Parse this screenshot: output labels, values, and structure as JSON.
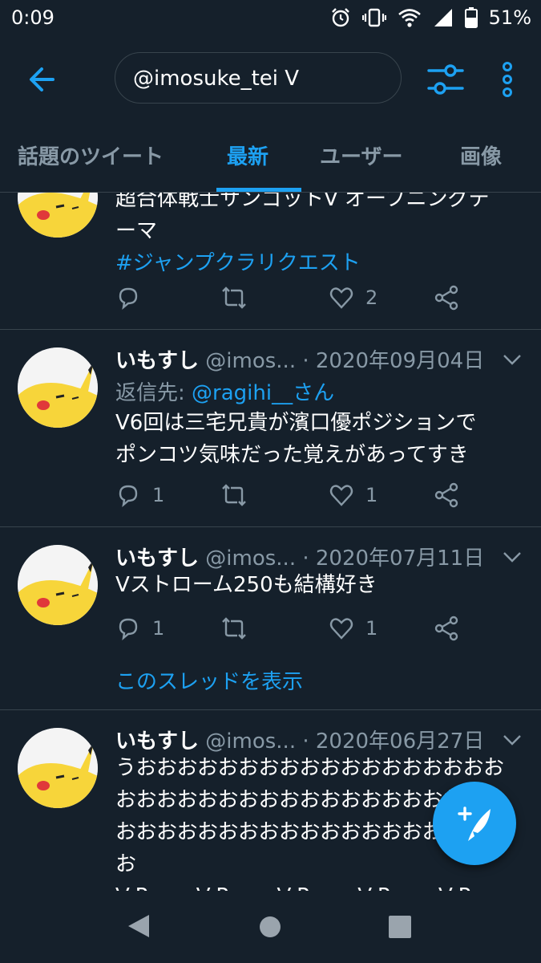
{
  "status": {
    "time": "0:09",
    "battery": "51%",
    "icons": [
      "alarm-icon",
      "vibrate-icon",
      "wifi-icon",
      "signal-icon",
      "battery-icon"
    ]
  },
  "search": {
    "query": "@imosuke_tei V"
  },
  "tabs": [
    {
      "label": "話題のツイート",
      "active": false
    },
    {
      "label": "最新",
      "active": true
    },
    {
      "label": "ユーザー",
      "active": false
    },
    {
      "label": "画像",
      "active": false
    }
  ],
  "colors": {
    "background": "#15202b",
    "accent": "#1da1f2",
    "secondary_text": "#8899a6",
    "divider": "#38444d"
  },
  "tweets": [
    {
      "lines": [
        "超合体戦士サンゴットV オープニングテ",
        "ーマ"
      ],
      "hashtag": "#ジャンプクラリクエスト",
      "likes": "2"
    },
    {
      "name": "いもすし",
      "handle": "@imos...",
      "date": "· 2020年09月04日",
      "reply_label": "返信先:",
      "reply_link": "@ragihi__さん",
      "lines": [
        "V6回は三宅兄貴が濱口優ポジションで",
        "ポンコツ気味だった覚えがあってすき"
      ],
      "replies": "1",
      "likes": "1"
    },
    {
      "name": "いもすし",
      "handle": "@imos...",
      "date": "· 2020年07月11日",
      "lines": [
        "Vストローム250も結構好き"
      ],
      "replies": "1",
      "likes": "1",
      "thread_link": "このスレッドを表示"
    },
    {
      "name": "いもすし",
      "handle": "@imos...",
      "date": "· 2020年06月27日",
      "lines": [
        "うおおおおおおおおおおおおおおおおおお",
        "おおおおおおおおおおおおおおおおおおお",
        "おおおおおおおおおおおおおおおおおおお",
        "お",
        "V-PowerV-PowerV-PowerV-PowerV-Pow"
      ]
    }
  ]
}
